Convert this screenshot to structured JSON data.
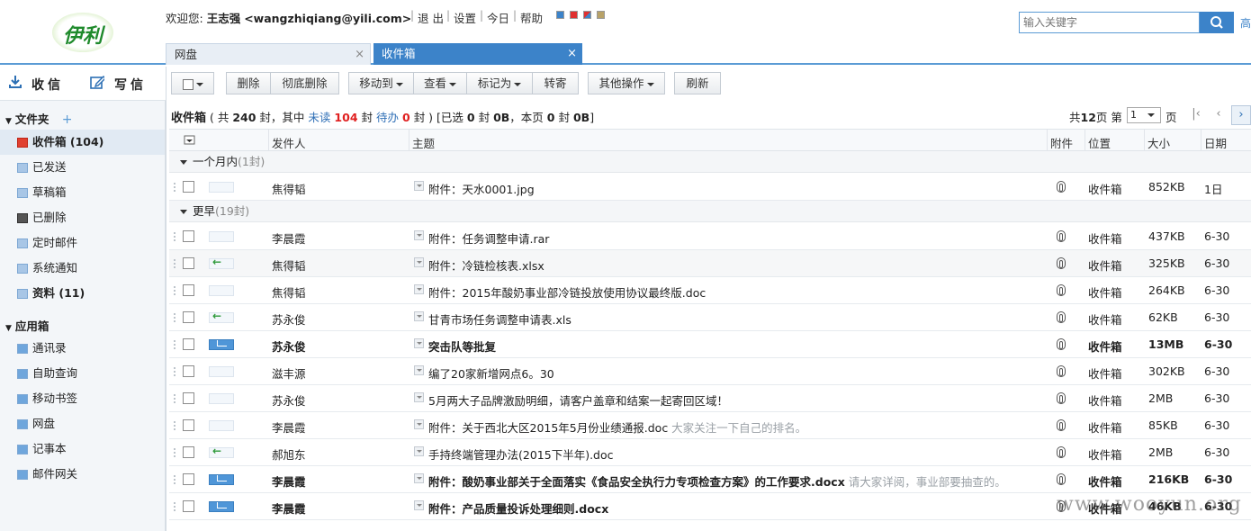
{
  "header": {
    "logo_text": "伊利",
    "welcome_prefix": "欢迎您:",
    "user_name": "王志强",
    "user_email": "<wangzhiqiang@yili.com>",
    "links": [
      "退 出",
      "设置",
      "今日",
      "帮助"
    ],
    "skin_colors": [
      "#3c83c9",
      "#e03030",
      "#d04848",
      "#b8a268"
    ],
    "search_placeholder": "输入关键字",
    "advanced_search": "高"
  },
  "tabs": [
    {
      "label": "网盘",
      "close": "×"
    },
    {
      "label": "收件箱",
      "close": "×"
    }
  ],
  "sidebar": {
    "receive": "收信",
    "compose": "写信",
    "folders_title": "文件夹",
    "add": "+",
    "folders": [
      {
        "label": "收件箱 (104)"
      },
      {
        "label": "已发送"
      },
      {
        "label": "草稿箱"
      },
      {
        "label": "已删除"
      },
      {
        "label": "定时邮件"
      },
      {
        "label": "系统通知"
      },
      {
        "label": "资料 (11)"
      }
    ],
    "apps_title": "应用箱",
    "apps": [
      {
        "label": "通讯录"
      },
      {
        "label": "自助查询"
      },
      {
        "label": "移动书签"
      },
      {
        "label": "网盘"
      },
      {
        "label": "记事本"
      },
      {
        "label": "邮件网关"
      }
    ]
  },
  "toolbar": {
    "delete": "删除",
    "delete_forever": "彻底删除",
    "move_to": "移动到",
    "view": "查看",
    "mark_as": "标记为",
    "forward": "转寄",
    "more": "其他操作",
    "refresh": "刷新"
  },
  "summary": {
    "title": "收件箱",
    "p1": "( 共",
    "total": "240",
    "p2": "封，其中",
    "unread_label": "未读",
    "unread": "104",
    "p3": "封",
    "todo_label": "待办",
    "todo": "0",
    "p4": "封 ) [已选",
    "selected": "0",
    "p5": "封",
    "selected_size": "0B",
    "p6": "，本页",
    "page_count": "0",
    "p7": "封",
    "page_size": "0B",
    "p8": "]"
  },
  "pager": {
    "text_prefix": "共",
    "pages": "12",
    "text_mid": "页 第",
    "current": "1",
    "text_suffix": "页"
  },
  "columns": {
    "sender": "发件人",
    "subject": "主题",
    "attach": "附件",
    "location": "位置",
    "size": "大小",
    "date": "日期"
  },
  "groups": [
    {
      "label": "一个月内",
      "count": "(1封)"
    },
    {
      "label": "更早",
      "count": "(19封)"
    }
  ],
  "rows": [
    {
      "sender": "焦得韬",
      "subject": "附件：天水0001.jpg",
      "preview": "",
      "location": "收件箱",
      "size": "852KB",
      "date": "1日"
    },
    {
      "sender": "李晨霞",
      "subject": "附件：任务调整申请.rar",
      "preview": "",
      "location": "收件箱",
      "size": "437KB",
      "date": "6-30"
    },
    {
      "sender": "焦得韬",
      "subject": "附件：冷链检核表.xlsx",
      "preview": "",
      "location": "收件箱",
      "size": "325KB",
      "date": "6-30"
    },
    {
      "sender": "焦得韬",
      "subject": "附件：2015年酸奶事业部冷链投放使用协议最终版.doc",
      "preview": "",
      "location": "收件箱",
      "size": "264KB",
      "date": "6-30"
    },
    {
      "sender": "苏永俊",
      "subject": "甘青市场任务调整申请表.xls",
      "preview": "",
      "location": "收件箱",
      "size": "62KB",
      "date": "6-30"
    },
    {
      "sender": "苏永俊",
      "subject": "突击队等批复",
      "preview": "",
      "location": "收件箱",
      "size": "13MB",
      "date": "6-30"
    },
    {
      "sender": "滋丰源",
      "subject": "编了20家新增网点6。30",
      "preview": "",
      "location": "收件箱",
      "size": "302KB",
      "date": "6-30"
    },
    {
      "sender": "苏永俊",
      "subject": "5月两大子品牌激励明细，请客户盖章和结案一起寄回区域！",
      "preview": "",
      "location": "收件箱",
      "size": "2MB",
      "date": "6-30"
    },
    {
      "sender": "李晨霞",
      "subject": "附件：关于西北大区2015年5月份业绩通报.doc",
      "preview": " 大家关注一下自己的排名。",
      "location": "收件箱",
      "size": "85KB",
      "date": "6-30"
    },
    {
      "sender": "郝旭东",
      "subject": "手持终端管理办法(2015下半年).doc",
      "preview": "",
      "location": "收件箱",
      "size": "2MB",
      "date": "6-30"
    },
    {
      "sender": "李晨霞",
      "subject": "附件：酸奶事业部关于全面落实《食品安全执行力专项检查方案》的工作要求.docx",
      "preview": " 请大家详阅，事业部要抽查的。",
      "location": "收件箱",
      "size": "216KB",
      "date": "6-30"
    },
    {
      "sender": "李晨霞",
      "subject": "附件：产品质量投诉处理细则.docx",
      "preview": "",
      "location": "收件箱",
      "size": "46KB",
      "date": "6-30"
    }
  ],
  "watermark": "www.wooyun.org"
}
